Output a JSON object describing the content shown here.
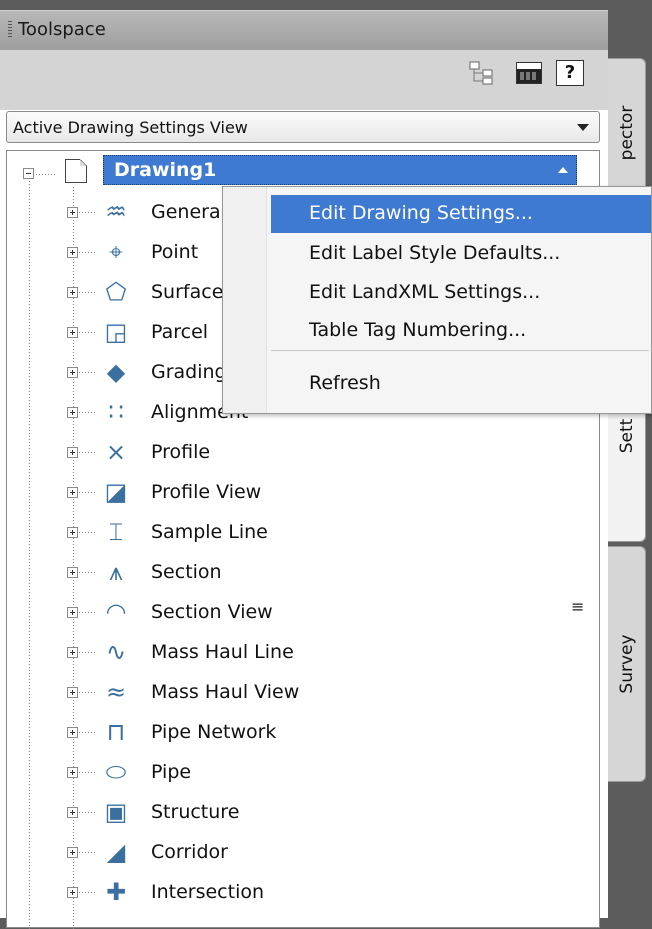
{
  "toolspace": {
    "title": "Toolspace",
    "toolbar": {
      "icons": [
        "tree-view-icon",
        "grid-view-icon",
        "help-icon"
      ],
      "help_label": "?"
    },
    "view_select": {
      "value": "Active Drawing Settings View"
    },
    "tree": {
      "root_label": "Drawing1",
      "items": [
        {
          "label": "General",
          "icon": "general-icon"
        },
        {
          "label": "Point",
          "icon": "point-icon"
        },
        {
          "label": "Surface",
          "icon": "surface-icon"
        },
        {
          "label": "Parcel",
          "icon": "parcel-icon"
        },
        {
          "label": "Grading",
          "icon": "grading-icon"
        },
        {
          "label": "Alignment",
          "icon": "alignment-icon"
        },
        {
          "label": "Profile",
          "icon": "profile-icon"
        },
        {
          "label": "Profile View",
          "icon": "profile-view-icon"
        },
        {
          "label": "Sample Line",
          "icon": "sample-line-icon"
        },
        {
          "label": "Section",
          "icon": "section-icon"
        },
        {
          "label": "Section View",
          "icon": "section-view-icon"
        },
        {
          "label": "Mass Haul Line",
          "icon": "mass-haul-line-icon"
        },
        {
          "label": "Mass Haul View",
          "icon": "mass-haul-view-icon"
        },
        {
          "label": "Pipe Network",
          "icon": "pipe-network-icon"
        },
        {
          "label": "Pipe",
          "icon": "pipe-icon"
        },
        {
          "label": "Structure",
          "icon": "structure-icon"
        },
        {
          "label": "Corridor",
          "icon": "corridor-icon"
        },
        {
          "label": "Intersection",
          "icon": "intersection-icon"
        }
      ]
    },
    "side_tabs": {
      "prospector": "pector",
      "settings": "Sett",
      "survey": "Survey"
    }
  },
  "context_menu": {
    "items": [
      {
        "label": "Edit Drawing Settings...",
        "highlighted": true
      },
      {
        "label": "Edit Label Style Defaults..."
      },
      {
        "label": "Edit LandXML Settings..."
      },
      {
        "label": "Table Tag Numbering..."
      },
      {
        "label": "Refresh"
      }
    ]
  },
  "colors": {
    "selection": "#3f7ad2",
    "titlebar": "#a8a8a8",
    "background": "#5c5c5c"
  }
}
